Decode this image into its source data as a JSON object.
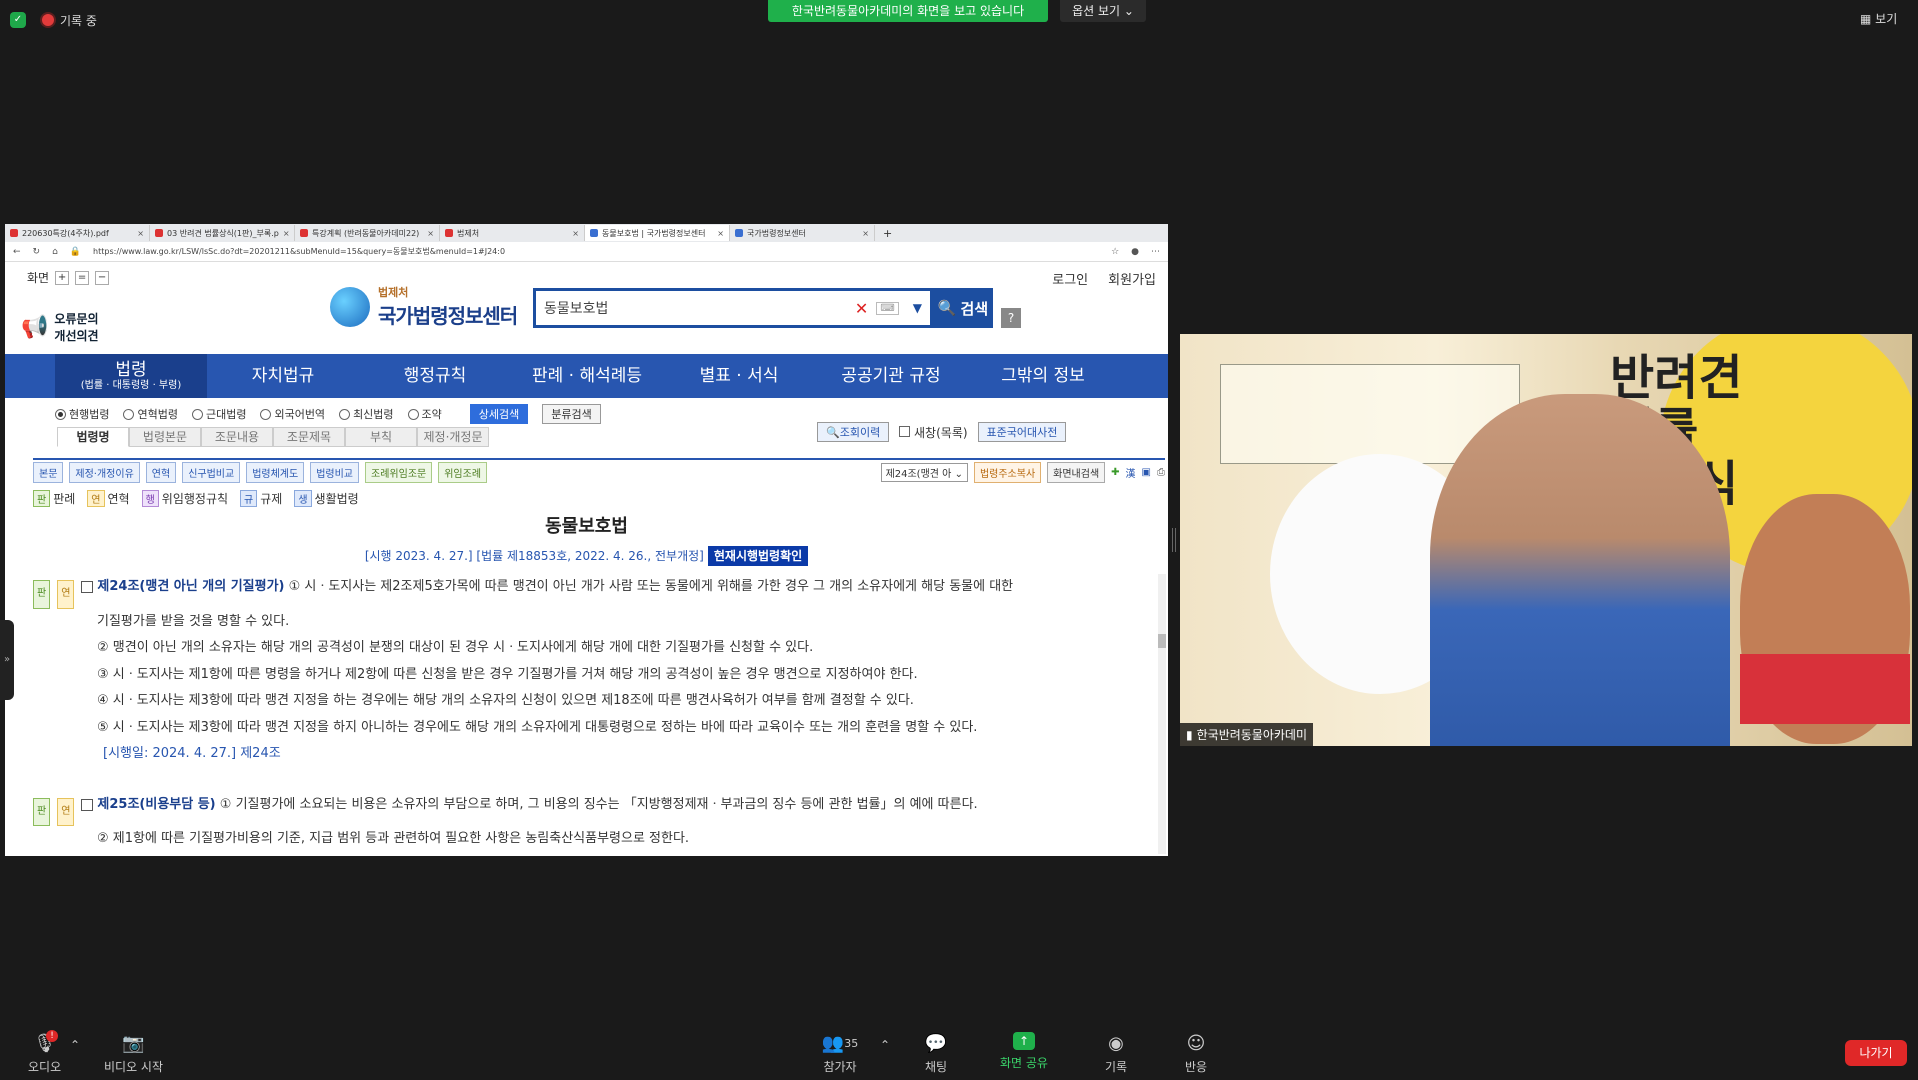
{
  "zoom": {
    "recording_label": "기록 중",
    "share_banner": "한국반려동물아카데미의 화면을 보고 있습니다",
    "view_options": "옵션 보기",
    "layout_label": "보기"
  },
  "browser": {
    "tabs": [
      {
        "title": "220630특강(4주차).pdf"
      },
      {
        "title": "03 반려견 법률상식(1판)_부록.p"
      },
      {
        "title": "특강계획 (반려동물아카데미22)"
      },
      {
        "title": "법제처"
      },
      {
        "title": "동물보호법 | 국가법령정보센터"
      },
      {
        "title": "국가법령정보센터"
      }
    ],
    "url": "https://www.law.go.kr/LSW/lsSc.do?dt=20201211&subMenuId=15&query=동물보호법&menuId=1#J24:0"
  },
  "site": {
    "screen_label": "화면",
    "login": "로그인",
    "signup": "회원가입",
    "feedback": {
      "line1": "오류문의",
      "line2": "개선의견"
    },
    "logo_small": "법제처",
    "logo_main": "국가법령정보센터",
    "search_value": "동물보호법",
    "search_button": "검색",
    "help": "?",
    "nav": [
      {
        "label": "법령",
        "sub": "(법률 · 대통령령 · 부령)"
      },
      {
        "label": "자치법규",
        "sub": ""
      },
      {
        "label": "행정규칙",
        "sub": ""
      },
      {
        "label": "판례 · 해석례등",
        "sub": ""
      },
      {
        "label": "별표 · 서식",
        "sub": ""
      },
      {
        "label": "공공기관 규정",
        "sub": ""
      },
      {
        "label": "그밖의 정보",
        "sub": ""
      }
    ],
    "filters": [
      "현행법령",
      "연혁법령",
      "근대법령",
      "외국어번역",
      "최신법령",
      "조약"
    ],
    "detail_search": "상세검색",
    "class_search": "분류검색",
    "subtabs": [
      "법령명",
      "법령본문",
      "조문내용",
      "조문제목",
      "부칙",
      "제정·개정문"
    ],
    "history": "조회이력",
    "new_window": "새창(목록)",
    "dictionary": "표준국어대사전",
    "tools": [
      "본문",
      "제정·개정이유",
      "연혁",
      "신구법비교",
      "법령체계도",
      "법령비교",
      "조례위임조문",
      "위임조례"
    ],
    "article_select": "제24조(맹견 아",
    "copy_address": "법령주소복사",
    "screen_search": "화면내검색",
    "legend": [
      {
        "tag": "판",
        "label": "판례"
      },
      {
        "tag": "연",
        "label": "연혁"
      },
      {
        "tag": "행",
        "label": "위임행정규칙"
      },
      {
        "tag": "규",
        "label": "규제"
      },
      {
        "tag": "생",
        "label": "생활법령"
      }
    ],
    "law_title": "동물보호법",
    "law_meta": "[시행 2023. 4. 27.] [법률 제18853호, 2022. 4. 26., 전부개정]",
    "current_button": "현재시행법령확인",
    "art24": {
      "title": "제24조(맹견 아닌 개의 기질평가)",
      "p1a": "① 시ㆍ도지사는 제2조제5호가목에 따른 맹견이 아닌 개가 사람 또는 동물에게 위해를 가한 경우 그 개의 소유자에게 해당 동물에 대한",
      "p1b": "기질평가를 받을 것을 명할 수 있다.",
      "p2": "② 맹견이 아닌 개의 소유자는 해당 개의 공격성이 분쟁의 대상이 된 경우 시ㆍ도지사에게 해당 개에 대한 기질평가를 신청할 수 있다.",
      "p3": "③ 시ㆍ도지사는 제1항에 따른 명령을 하거나 제2항에 따른 신청을 받은 경우 기질평가를 거쳐 해당 개의 공격성이 높은 경우 맹견으로 지정하여야 한다.",
      "p4": "④ 시ㆍ도지사는 제3항에 따라 맹견 지정을 하는 경우에는 해당 개의 소유자의 신청이 있으면 제18조에 따른 맹견사육허가 여부를 함께 결정할 수 있다.",
      "p5": "⑤ 시ㆍ도지사는 제3항에 따라 맹견 지정을 하지 아니하는 경우에도 해당 개의 소유자에게 대통령령으로 정하는 바에 따라 교육이수 또는 개의 훈련을 명할 수 있다.",
      "eff": "[시행일: 2024. 4. 27.] 제24조"
    },
    "art25": {
      "title": "제25조(비용부담 등)",
      "p1": "① 기질평가에 소요되는 비용은 소유자의 부담으로 하며, 그 비용의 징수는 「지방행정제재ㆍ부과금의 징수 등에 관한 법률」의 예에 따른다.",
      "p2": "② 제1항에 따른 기질평가비용의 기준, 지급 범위 등과 관련하여 필요한 사항은 농림축산식품부령으로 정한다."
    }
  },
  "video": {
    "book_title_1": "반려견",
    "book_title_2": "법률",
    "book_title_3": "상식",
    "participant_name": "한국반려동물아카데미"
  },
  "toolbar": {
    "audio": "오디오",
    "video": "비디오 시작",
    "participants": "참가자",
    "participants_count": "35",
    "chat": "채팅",
    "share": "화면 공유",
    "record": "기록",
    "reactions": "반응",
    "leave": "나가기",
    "audio_badge": "!"
  }
}
